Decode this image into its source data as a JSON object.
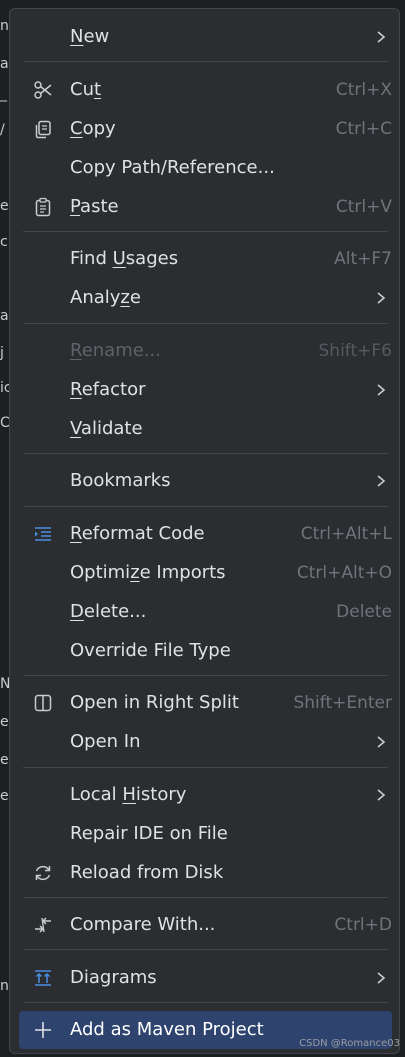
{
  "background_fragments": [
    "n",
    "a",
    "_",
    "/",
    "e",
    "c",
    "al",
    "j",
    "ic",
    "C",
    "N",
    "e",
    "e",
    "e",
    "ne"
  ],
  "menu": {
    "items": [
      {
        "label_pre": "",
        "mnemonic": "N",
        "label_post": "ew",
        "shortcut": "",
        "submenu": true,
        "icon": ""
      },
      {
        "label_pre": "Cu",
        "mnemonic": "t",
        "label_post": "",
        "shortcut": "Ctrl+X",
        "submenu": false,
        "icon": "scissors-icon"
      },
      {
        "label_pre": "",
        "mnemonic": "C",
        "label_post": "opy",
        "shortcut": "Ctrl+C",
        "submenu": false,
        "icon": "copy-icon"
      },
      {
        "label_pre": "Copy Path/Reference...",
        "mnemonic": "",
        "label_post": "",
        "shortcut": "",
        "submenu": false,
        "icon": ""
      },
      {
        "label_pre": "",
        "mnemonic": "P",
        "label_post": "aste",
        "shortcut": "Ctrl+V",
        "submenu": false,
        "icon": "clipboard-icon"
      },
      {
        "label_pre": "Find ",
        "mnemonic": "U",
        "label_post": "sages",
        "shortcut": "Alt+F7",
        "submenu": false,
        "icon": ""
      },
      {
        "label_pre": "Analy",
        "mnemonic": "z",
        "label_post": "e",
        "shortcut": "",
        "submenu": true,
        "icon": ""
      },
      {
        "label_pre": "",
        "mnemonic": "R",
        "label_post": "ename...",
        "shortcut": "Shift+F6",
        "submenu": false,
        "icon": "",
        "disabled": true
      },
      {
        "label_pre": "",
        "mnemonic": "R",
        "label_post": "efactor",
        "shortcut": "",
        "submenu": true,
        "icon": ""
      },
      {
        "label_pre": "",
        "mnemonic": "V",
        "label_post": "alidate",
        "shortcut": "",
        "submenu": false,
        "icon": ""
      },
      {
        "label_pre": "Bookmarks",
        "mnemonic": "",
        "label_post": "",
        "shortcut": "",
        "submenu": true,
        "icon": ""
      },
      {
        "label_pre": "",
        "mnemonic": "R",
        "label_post": "eformat Code",
        "shortcut": "Ctrl+Alt+L",
        "submenu": false,
        "icon": "reformat-icon"
      },
      {
        "label_pre": "Optimi",
        "mnemonic": "z",
        "label_post": "e Imports",
        "shortcut": "Ctrl+Alt+O",
        "submenu": false,
        "icon": ""
      },
      {
        "label_pre": "",
        "mnemonic": "D",
        "label_post": "elete...",
        "shortcut": "Delete",
        "submenu": false,
        "icon": ""
      },
      {
        "label_pre": "Override File Type",
        "mnemonic": "",
        "label_post": "",
        "shortcut": "",
        "submenu": false,
        "icon": ""
      },
      {
        "label_pre": "Open in Right Split",
        "mnemonic": "",
        "label_post": "",
        "shortcut": "Shift+Enter",
        "submenu": false,
        "icon": "split-icon"
      },
      {
        "label_pre": "Open In",
        "mnemonic": "",
        "label_post": "",
        "shortcut": "",
        "submenu": true,
        "icon": ""
      },
      {
        "label_pre": "Local ",
        "mnemonic": "H",
        "label_post": "istory",
        "shortcut": "",
        "submenu": true,
        "icon": ""
      },
      {
        "label_pre": "Repair IDE on File",
        "mnemonic": "",
        "label_post": "",
        "shortcut": "",
        "submenu": false,
        "icon": ""
      },
      {
        "label_pre": "Reload from Disk",
        "mnemonic": "",
        "label_post": "",
        "shortcut": "",
        "submenu": false,
        "icon": "reload-icon"
      },
      {
        "label_pre": "Compare With...",
        "mnemonic": "",
        "label_post": "",
        "shortcut": "Ctrl+D",
        "submenu": false,
        "icon": "compare-icon"
      },
      {
        "label_pre": "Diagrams",
        "mnemonic": "",
        "label_post": "",
        "shortcut": "",
        "submenu": true,
        "icon": "diagram-icon"
      },
      {
        "label_pre": "Add as Maven Project",
        "mnemonic": "",
        "label_post": "",
        "shortcut": "",
        "submenu": false,
        "icon": "plus-icon",
        "highlighted": true
      }
    ]
  },
  "watermark": "CSDN @Romance03",
  "colors": {
    "menu_bg": "#2b2d30",
    "highlight": "#2e436e",
    "separator": "#43454a",
    "text": "#dfe1e5",
    "shortcut": "#6f737a",
    "icon_blue": "#4a8fe2"
  }
}
